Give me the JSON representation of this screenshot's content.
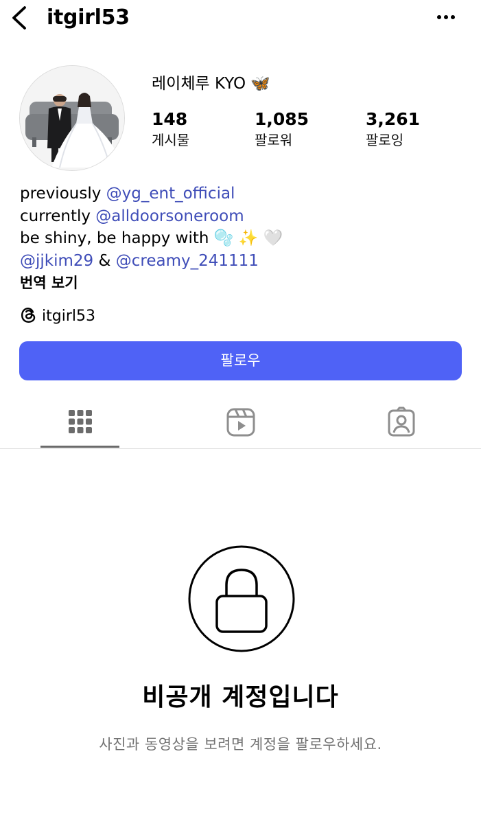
{
  "header": {
    "username": "itgirl53",
    "back_icon": "chevron-left-icon",
    "more_icon": "more-horizontal-icon"
  },
  "profile": {
    "display_name": "레이체루 KYO",
    "display_name_emoji": "🦋",
    "stats": [
      {
        "value": "148",
        "label": "게시물"
      },
      {
        "value": "1,085",
        "label": "팔로워"
      },
      {
        "value": "3,261",
        "label": "팔로잉"
      }
    ]
  },
  "bio": {
    "line1_text": "previously ",
    "line1_mention": "@yg_ent_official",
    "line2_text": "currently ",
    "line2_mention": "@alldoorsoneroom",
    "line3_text": "be shiny, be happy with ",
    "line3_emojis": "🫧 ✨ 🤍",
    "line4_mention_a": "@jjkim29",
    "line4_and": " & ",
    "line4_mention_b": "@creamy_241111",
    "translate": "번역 보기",
    "threads_handle": "itgirl53"
  },
  "follow_button": {
    "label": "팔로우",
    "color": "#4f62f6"
  },
  "tabs": [
    {
      "name": "posts-grid",
      "icon": "grid-icon",
      "active": true
    },
    {
      "name": "reels",
      "icon": "reels-icon",
      "active": false
    },
    {
      "name": "tagged",
      "icon": "tagged-person-icon",
      "active": false
    }
  ],
  "private": {
    "icon": "lock-icon",
    "title": "비공개 계정입니다",
    "subtitle": "사진과 동영상을 보려면 계정을 팔로우하세요."
  },
  "colors": {
    "mention": "#3f4db8",
    "muted": "#737373",
    "divider": "#dbdbdb"
  }
}
